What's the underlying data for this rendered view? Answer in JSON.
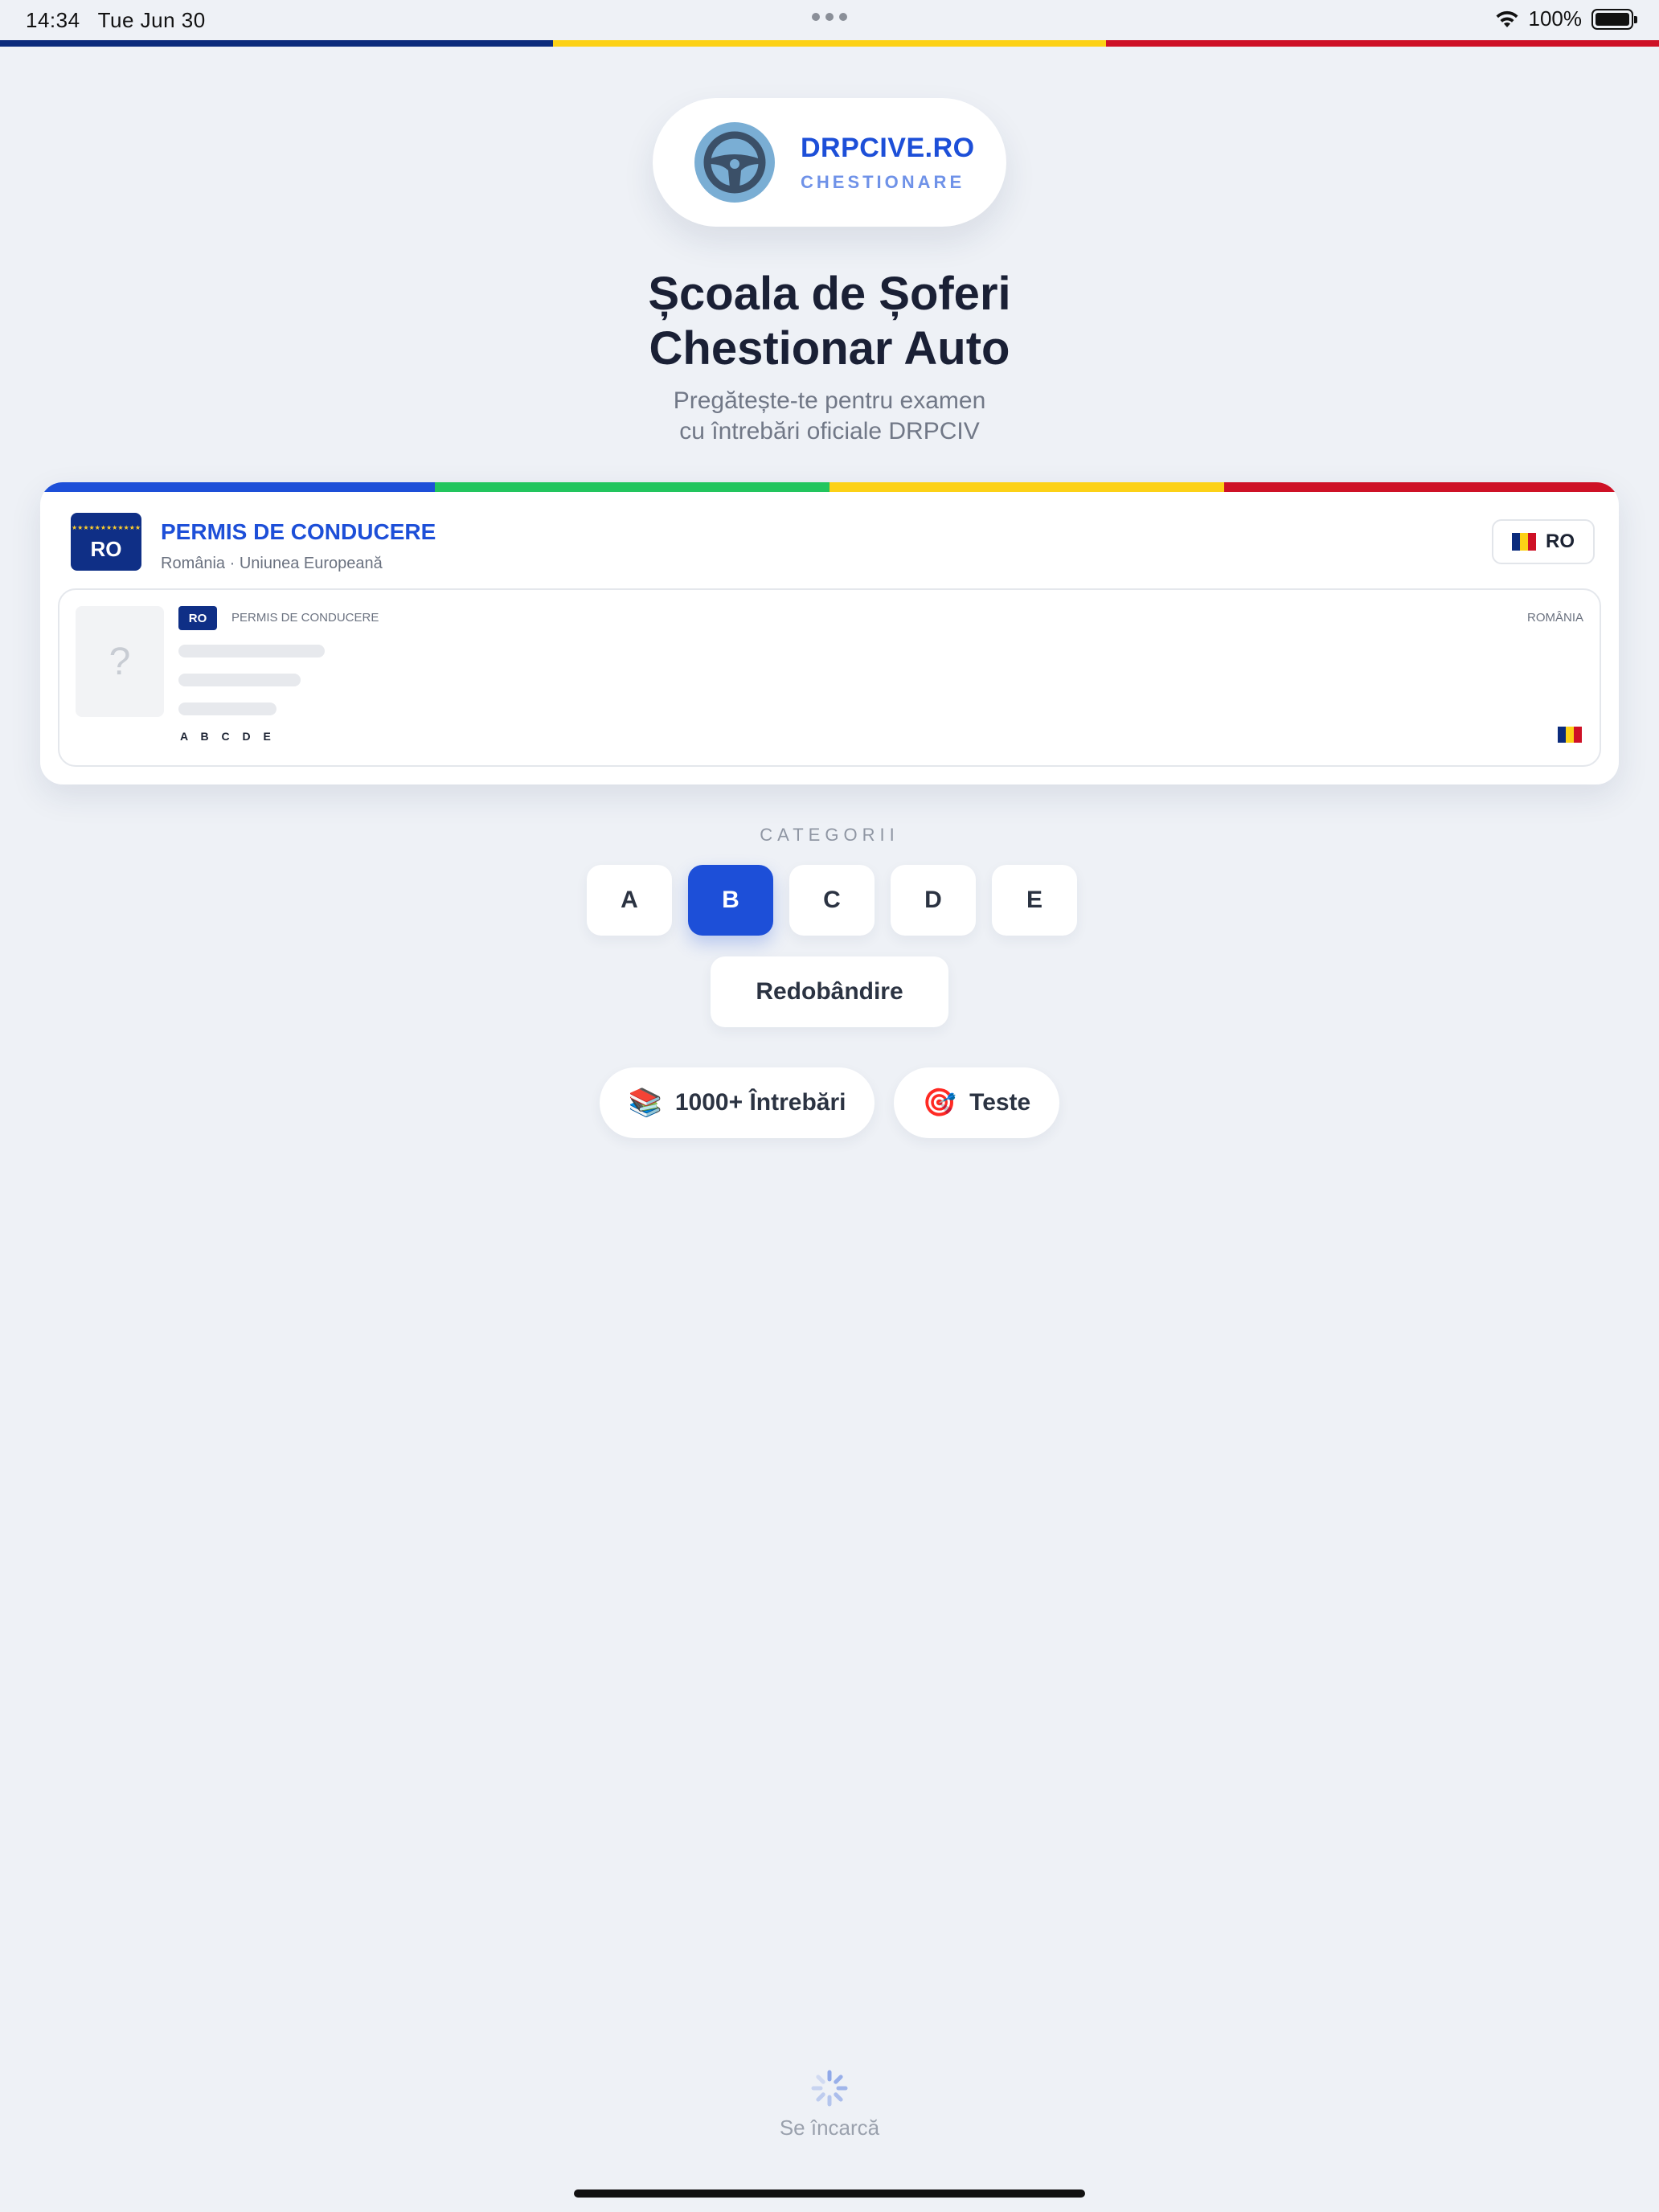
{
  "status_bar": {
    "time": "14:34",
    "date": "Tue Jun 30",
    "battery": "100%"
  },
  "colors": {
    "ro_blue": "#0b2b7c",
    "ro_yellow": "#fcd116",
    "ro_red": "#ce1126",
    "accent": "#1d4fd8",
    "stripe_green": "#22c55e"
  },
  "brand": {
    "name": "DRPCIVE.RO",
    "subtitle": "CHESTIONARE",
    "icon": "steering-wheel-icon"
  },
  "hero": {
    "title_line1": "Școala de Șoferi",
    "title_line2": "Chestionar Auto",
    "subtitle_line1": "Pregătește-te pentru examen",
    "subtitle_line2": "cu întrebări oficiale DRPCIV"
  },
  "license_card": {
    "badge": "RO",
    "title": "PERMIS DE CONDUCERE",
    "subtitle": "România · Uniunea Europeană",
    "language_button": "RO",
    "preview": {
      "badge": "RO",
      "title": "PERMIS DE CONDUCERE",
      "country": "ROMÂNIA",
      "photo_placeholder": "?",
      "categories": "A B C D E"
    }
  },
  "categories": {
    "label": "CATEGORII",
    "items": [
      "A",
      "B",
      "C",
      "D",
      "E"
    ],
    "selected": "B",
    "extra": "Redobândire"
  },
  "chips": [
    {
      "icon": "books-icon",
      "label": "1000+ Întrebări"
    },
    {
      "icon": "target-icon",
      "label": "Teste"
    }
  ],
  "loading": {
    "text": "Se încarcă"
  }
}
